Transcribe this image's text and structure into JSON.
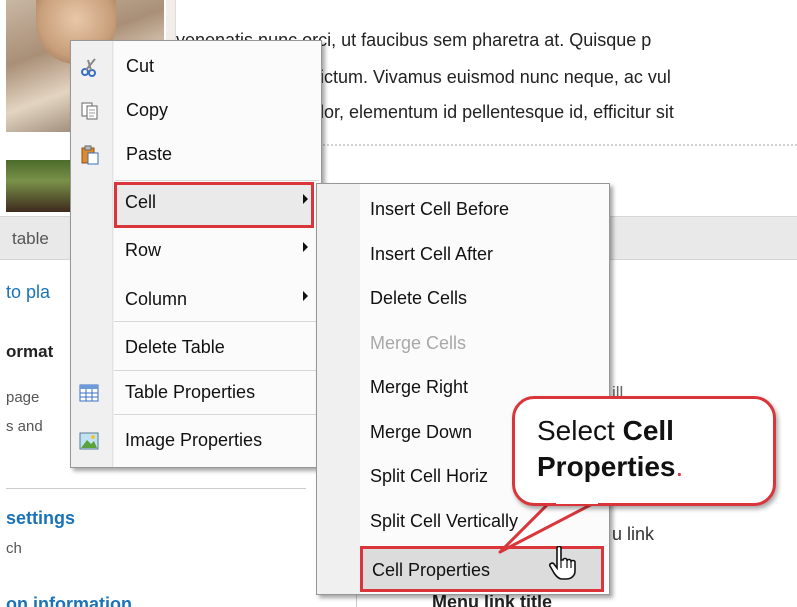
{
  "background": {
    "paragraph_lines": [
      "venenatis nunc orci, ut faucibus sem pharetra at. Quisque p",
      "dictum. Vivamus euismod nunc neque, ac vul",
      "plor, elementum id pellentesque id, efficitur sit"
    ],
    "grey_bar_label": "table",
    "left_link": "to pla",
    "left_heading": "ormat",
    "left_small_lines": [
      "page",
      "s and"
    ],
    "settings_link": "settings",
    "settings_small": "ch",
    "bottom_link": "on information",
    "right_fragment_1": "ill",
    "right_fragment_2": "u link",
    "right_bold": "Menu link title"
  },
  "context_menu": {
    "items": [
      {
        "label": "Cut",
        "icon": "scissors-icon",
        "submenu": false
      },
      {
        "label": "Copy",
        "icon": "copy-icon",
        "submenu": false
      },
      {
        "label": "Paste",
        "icon": "paste-icon",
        "submenu": false
      },
      {
        "label": "Cell",
        "icon": "",
        "submenu": true,
        "highlighted": true
      },
      {
        "label": "Row",
        "icon": "",
        "submenu": true
      },
      {
        "label": "Column",
        "icon": "",
        "submenu": true
      },
      {
        "label": "Delete Table",
        "icon": "",
        "submenu": false
      },
      {
        "label": "Table Properties",
        "icon": "table-icon",
        "submenu": false
      },
      {
        "label": "Image Properties",
        "icon": "image-icon",
        "submenu": false
      }
    ]
  },
  "cell_submenu": {
    "items": [
      {
        "label": "Insert Cell Before",
        "enabled": true
      },
      {
        "label": "Insert Cell After",
        "enabled": true
      },
      {
        "label": "Delete Cells",
        "enabled": true
      },
      {
        "label": "Merge Cells",
        "enabled": false
      },
      {
        "label": "Merge Right",
        "enabled": true
      },
      {
        "label": "Merge Down",
        "enabled": true
      },
      {
        "label": "Split Cell Horiz",
        "enabled": true
      },
      {
        "label": "Split Cell Vertically",
        "enabled": true
      },
      {
        "label": "Cell Properties",
        "enabled": true,
        "highlighted": true
      }
    ]
  },
  "callout": {
    "prefix": "Select ",
    "bold_1": "Cell",
    "bold_2": "Properties",
    "suffix": "."
  },
  "colors": {
    "highlight_border": "#d9353a",
    "link": "#1a73b8",
    "menu_bg": "#f0f0f0"
  }
}
